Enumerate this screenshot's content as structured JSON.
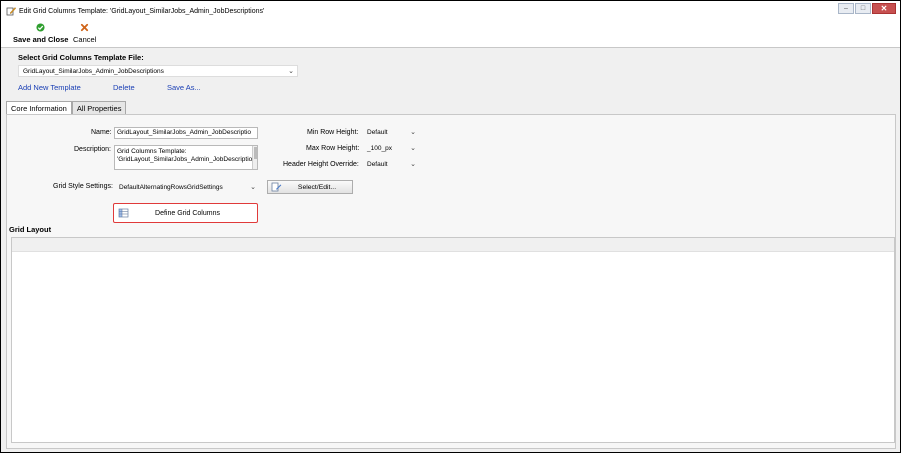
{
  "window": {
    "title": "Edit Grid Columns Template: 'GridLayout_SimilarJobs_Admin_JobDescriptions'",
    "controls": {
      "minimize": "‒",
      "restore": "□",
      "close": "✕"
    }
  },
  "toolbar": {
    "save_label": "Save and Close",
    "cancel_label": "Cancel"
  },
  "template_file": {
    "label": "Select Grid Columns Template File:",
    "selected": "GridLayout_SimilarJobs_Admin_JobDescriptions",
    "links": {
      "add": "Add New Template",
      "delete": "Delete",
      "save_as": "Save As..."
    }
  },
  "tabs": [
    {
      "label": "Core Information",
      "active": true
    },
    {
      "label": "All Properties",
      "active": false
    }
  ],
  "core": {
    "name_label": "Name:",
    "name_value": "GridLayout_SimilarJobs_Admin_JobDescriptio",
    "description_label": "Description:",
    "description_value": "Grid Columns Template: 'GridLayout_SimilarJobs_Admin_JobDescriptionc'",
    "style_label": "Grid Style Settings:",
    "style_value": "DefaultAlternatingRowsGridSettings",
    "select_edit_label": "Select/Edit...",
    "define_columns_label": "Define Grid Columns",
    "min_row_label": "Min Row Height:",
    "min_row_value": "Default",
    "max_row_label": "Max Row Height:",
    "max_row_value": "_100_px",
    "header_height_label": "Header Height Override:",
    "header_height_value": "Default"
  },
  "grid_layout": {
    "label": "Grid Layout"
  },
  "colors": {
    "link": "#1a3fb5",
    "highlight_border": "#e03a3a",
    "save_icon": "#2e9e2e",
    "cancel_icon": "#d0651a"
  }
}
